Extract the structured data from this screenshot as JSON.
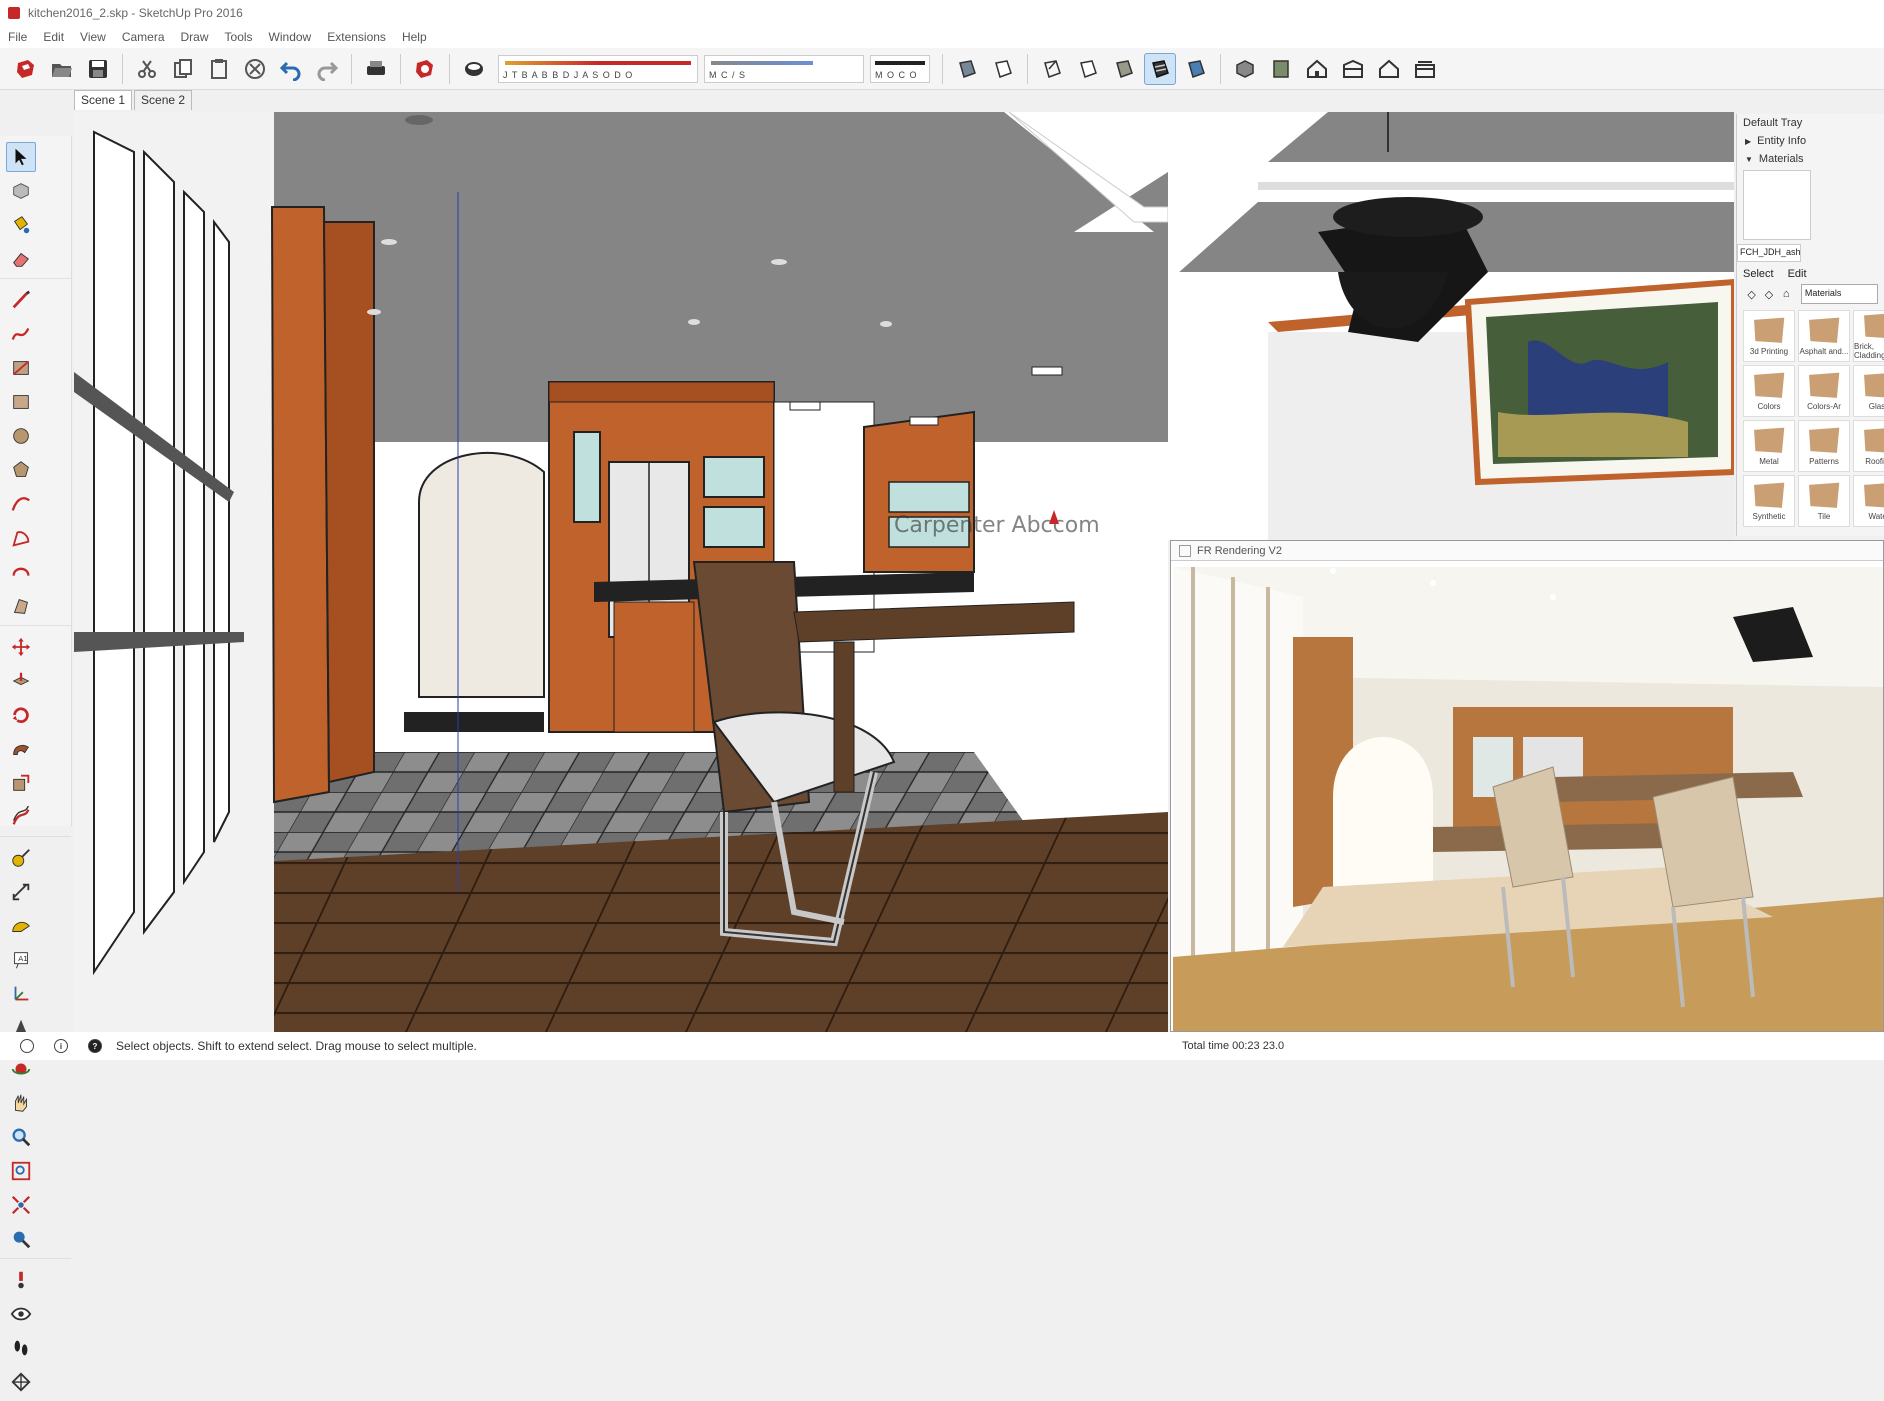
{
  "window": {
    "title": "kitchen2016_2.skp - SketchUp Pro 2016"
  },
  "menu": [
    "File",
    "Edit",
    "View",
    "Camera",
    "Draw",
    "Tools",
    "Window",
    "Extensions",
    "Help"
  ],
  "toolbar": {
    "icons": [
      "su-logo-icon",
      "open-icon",
      "save-icon",
      "cut-icon",
      "copy-icon",
      "paste-icon",
      "erase-icon",
      "undo-icon",
      "redo-icon",
      "print-icon",
      "model-info-icon",
      "materials-icon"
    ],
    "style_labels": [
      "J T B A B B D J A S O D O",
      "M C / S",
      "M O C O"
    ],
    "view_icons": [
      "xray-icon",
      "back-edges-icon",
      "wireframe-icon",
      "hidden-line-icon",
      "shaded-icon",
      "shaded-textures-icon",
      "monochrome-icon"
    ],
    "camera_icons": [
      "iso-icon",
      "top-icon",
      "front-icon",
      "right-icon",
      "back-icon",
      "left-icon"
    ]
  },
  "tabs": [
    "Scene 1",
    "Scene 2"
  ],
  "tray": {
    "title": "Default Tray",
    "sections": [
      {
        "label": "Entity Info",
        "expanded": false
      },
      {
        "label": "Materials",
        "expanded": true
      }
    ],
    "material_name": "FCH_JDH_ash",
    "subtabs": [
      "Select",
      "Edit"
    ],
    "library": "Materials",
    "materials": [
      "3d Printing",
      "Asphalt and...",
      "Brick, Cladding...",
      "Colors",
      "Colors-Ar",
      "Glass",
      "Metal",
      "Patterns",
      "Roofing",
      "Synthetic",
      "Tile",
      "Water"
    ]
  },
  "render_window": {
    "title": "FR Rendering V2",
    "status": "Total time 00:23 23.0"
  },
  "statusbar": {
    "hint": "Select objects. Shift to extend select. Drag mouse to select multiple."
  },
  "colors": {
    "cabinet": "#c0622c",
    "ceiling": "#8a8a8a",
    "floor": "#5e3f28",
    "accent": "#c62828",
    "selection": "#cfe3f7"
  },
  "watermark": "Carpenter Abccom"
}
